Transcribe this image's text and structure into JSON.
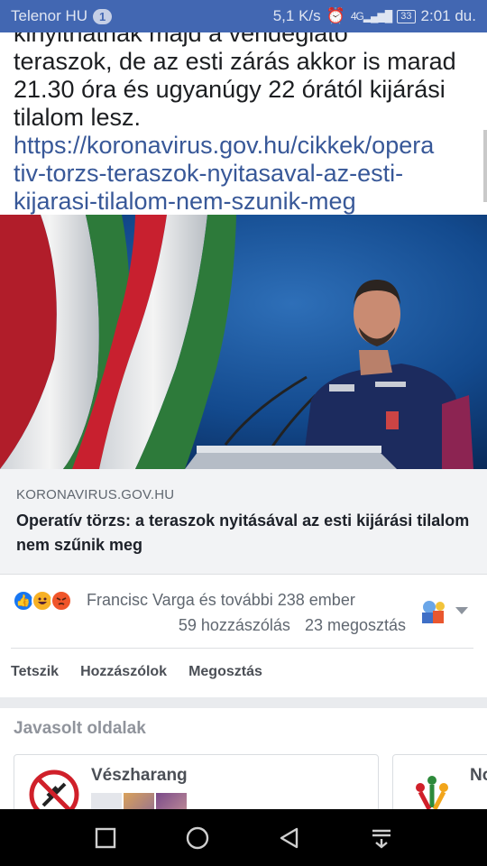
{
  "status_bar": {
    "carrier": "Telenor HU",
    "notification_count": "1",
    "network_speed": "5,1 K/s",
    "network_type": "4G",
    "battery": "33",
    "time": "2:01 du."
  },
  "post": {
    "text_lines": [
      "kinyithatnak majd a vendéglátó",
      "teraszok, de az esti zárás akkor is marad",
      "21.30 óra és ugyanúgy 22 órától kijárási",
      "tilalom lesz."
    ],
    "link_lines": [
      "https://koronavirus.gov.hu/cikkek/opera",
      "tiv-torzs-teraszok-nyitasaval-az-esti-",
      "kijarasi-tilalom-nem-szunik-meg"
    ]
  },
  "link_preview": {
    "domain": "KORONAVIRUS.GOV.HU",
    "title": "Operatív törzs: a teraszok nyitásával az esti kijárási tilalom nem szűnik meg"
  },
  "engagement": {
    "reaction_icons": [
      "like-icon",
      "haha-icon",
      "angry-icon"
    ],
    "reactors": "Francisc Varga és további 238 ember",
    "comments": "59 hozzászólás",
    "shares": "23 megosztás"
  },
  "actions": {
    "like": "Tetszik",
    "comment": "Hozzászólok",
    "share": "Megosztás"
  },
  "suggested_pages": {
    "heading": "Javasolt oldalak",
    "pages": [
      {
        "name": "Vészharang"
      },
      {
        "name": "No"
      }
    ]
  },
  "colors": {
    "brand": "#4267b2",
    "link": "#385898",
    "flag_red": "#c8202f",
    "flag_green": "#2d7a3a"
  }
}
